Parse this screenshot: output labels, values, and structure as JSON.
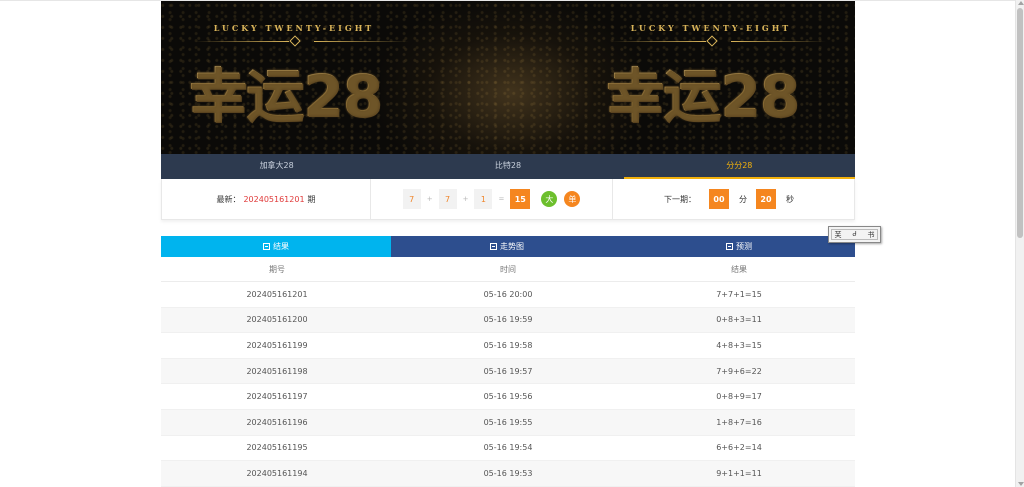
{
  "banner": {
    "subtitle": "LUCKY TWENTY-EIGHT",
    "title": "幸运28"
  },
  "lottery_tabs": [
    {
      "label": "加拿大28",
      "active": false
    },
    {
      "label": "比特28",
      "active": false
    },
    {
      "label": "分分28",
      "active": true
    }
  ],
  "latest": {
    "label": "最新：",
    "issue": "202405161201",
    "issue_suffix": "期",
    "numbers": [
      "7",
      "7",
      "1"
    ],
    "plus": "+",
    "equals": "=",
    "sum": "15",
    "size_badge": "大",
    "parity_badge": "单",
    "next_label": "下一期：",
    "minutes": "00",
    "minutes_unit": "分",
    "seconds": "20",
    "seconds_unit": "秒"
  },
  "view_tabs": [
    {
      "label": "结果",
      "icon": "calendar-icon",
      "active": true
    },
    {
      "label": "走势图",
      "icon": "chart-icon",
      "active": false
    },
    {
      "label": "预测",
      "icon": "document-icon",
      "active": false
    }
  ],
  "table": {
    "headers": [
      "期号",
      "时间",
      "结果"
    ],
    "rows": [
      [
        "202405161201",
        "05-16 20:00",
        "7+7+1=15"
      ],
      [
        "202405161200",
        "05-16 19:59",
        "0+8+3=11"
      ],
      [
        "202405161199",
        "05-16 19:58",
        "4+8+3=15"
      ],
      [
        "202405161198",
        "05-16 19:57",
        "7+9+6=22"
      ],
      [
        "202405161197",
        "05-16 19:56",
        "0+8+9=17"
      ],
      [
        "202405161196",
        "05-16 19:55",
        "1+8+7=16"
      ],
      [
        "202405161195",
        "05-16 19:54",
        "6+6+2=14"
      ],
      [
        "202405161194",
        "05-16 19:53",
        "9+1+1=11"
      ]
    ]
  },
  "widget": {
    "chars": [
      "芙",
      "Ꮷ",
      "书"
    ]
  },
  "colors": {
    "tab_bar": "#2d3a4f",
    "tab_active": "#f2b10c",
    "accent_orange": "#f5861f",
    "issue_red": "#e03a3a",
    "view_tab_active": "#00b4ee",
    "view_tab": "#2d4e8e",
    "badge_green": "#6dbf2d"
  }
}
